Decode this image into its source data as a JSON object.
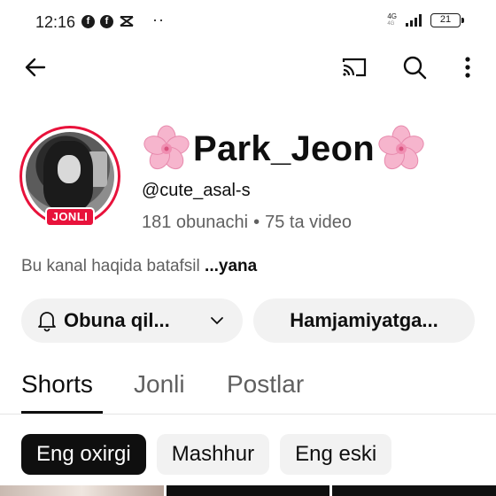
{
  "status_bar": {
    "time": "12:16",
    "network_top": "4G",
    "network_bottom": "4G",
    "battery": "21",
    "overflow": "··"
  },
  "toolbar": {
    "back_icon": "arrow-left-icon",
    "cast_icon": "cast-icon",
    "search_icon": "search-icon",
    "more_icon": "more-vert-icon"
  },
  "channel": {
    "name": "Park_Jeon",
    "handle": "@cute_asal-s",
    "subscribers": "181 obunachi",
    "separator": "•",
    "videos": "75 ta video",
    "live_badge": "JONLI",
    "about_text": "Bu kanal haqida batafsil",
    "about_more": "...yana"
  },
  "actions": {
    "subscribe_label": "Obuna qil...",
    "community_label": "Hamjamiyatga..."
  },
  "tabs": [
    {
      "label": "Shorts",
      "active": true
    },
    {
      "label": "Jonli",
      "active": false
    },
    {
      "label": "Postlar",
      "active": false
    }
  ],
  "filters": [
    {
      "label": "Eng oxirgi",
      "selected": true
    },
    {
      "label": "Mashhur",
      "selected": false
    },
    {
      "label": "Eng eski",
      "selected": false
    }
  ],
  "colors": {
    "accent_live": "#e8123b",
    "chip_selected": "#0f0f0f",
    "pill_bg": "#f2f2f2",
    "flower": "#f4a6c3"
  }
}
